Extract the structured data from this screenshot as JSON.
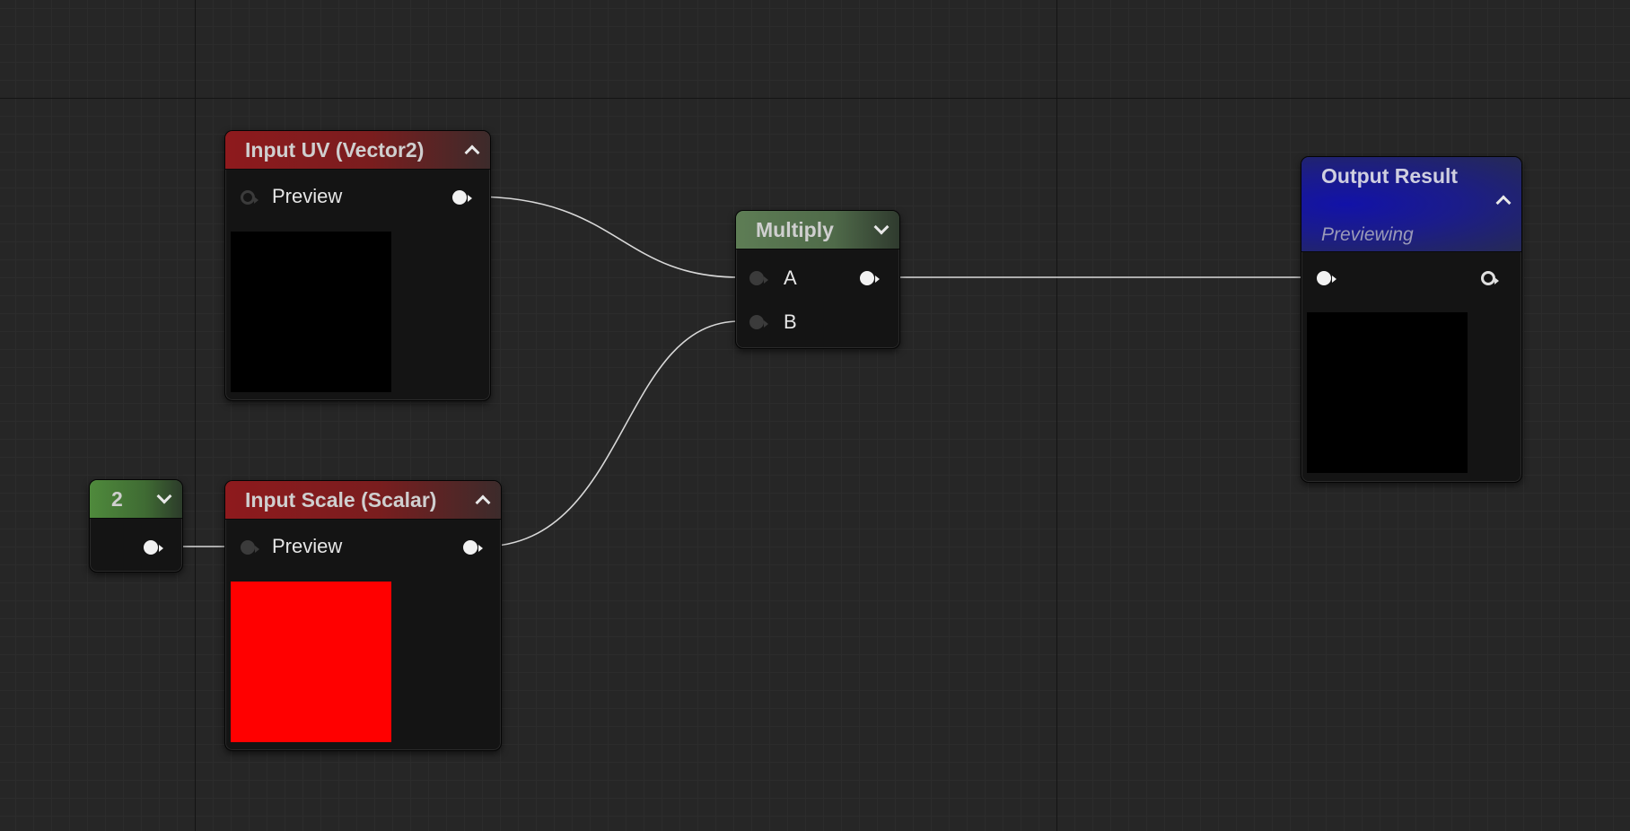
{
  "nodes": {
    "input_uv": {
      "title": "Input UV (Vector2)",
      "row_label": "Preview",
      "header_color": "#8e1a1d",
      "preview_color": "#000000"
    },
    "multiply": {
      "title": "Multiply",
      "input_a": "A",
      "input_b": "B",
      "header_color": "#5e7d55"
    },
    "output_result": {
      "title": "Output Result",
      "subtitle": "Previewing",
      "header_color": "#1212a8",
      "preview_color": "#000000"
    },
    "constant": {
      "value": "2",
      "header_color": "#4f8a3c"
    },
    "input_scale": {
      "title": "Input Scale (Scalar)",
      "row_label": "Preview",
      "header_color": "#8e1a1d",
      "preview_color": "#ff0000"
    }
  },
  "colors": {
    "canvas_background": "#262626",
    "wire": "#d8d8d8"
  }
}
